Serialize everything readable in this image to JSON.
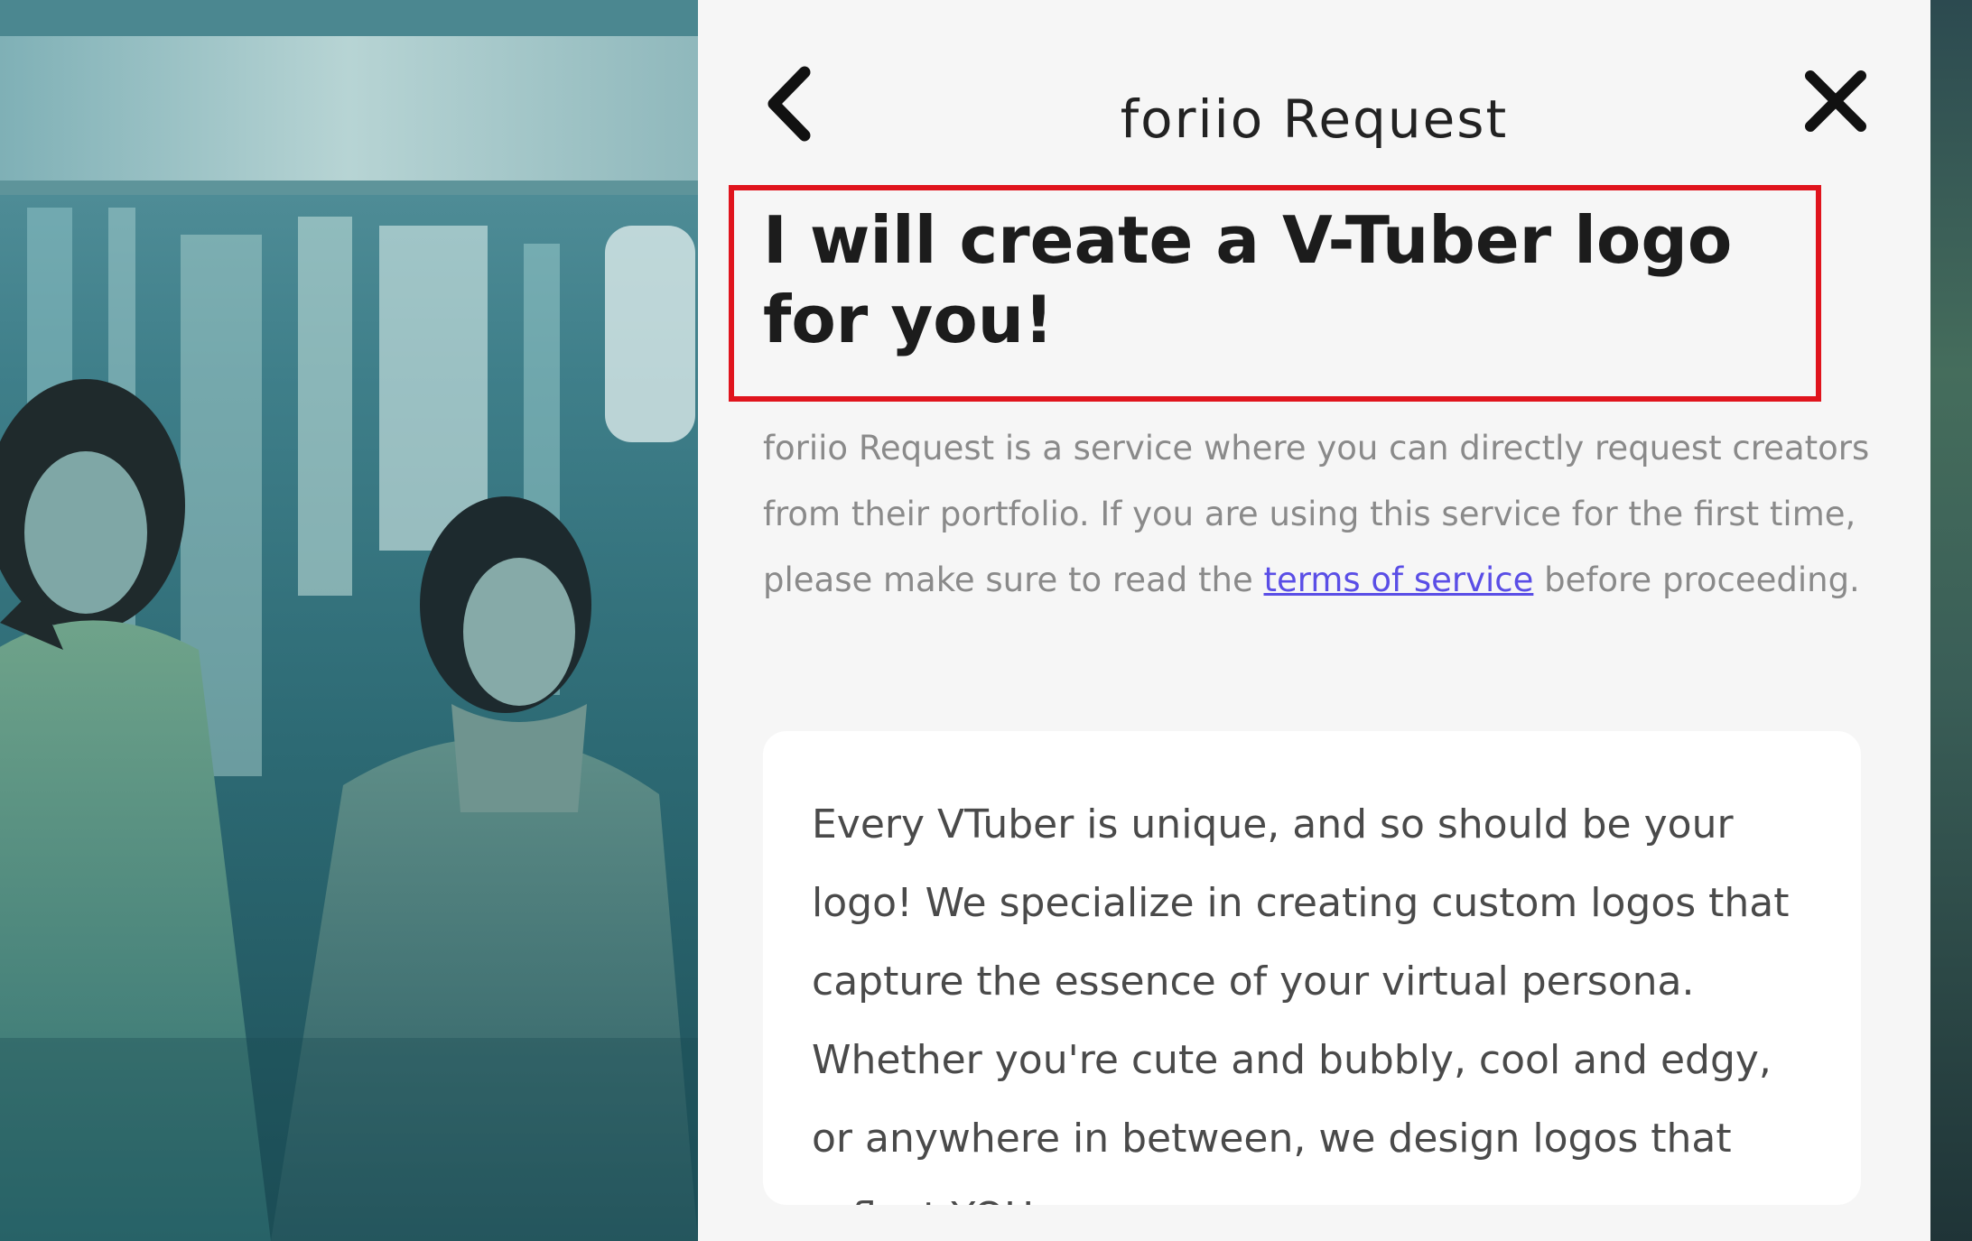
{
  "modal": {
    "title": "foriio Request",
    "back_icon": "chevron-left-icon",
    "close_icon": "close-icon"
  },
  "request": {
    "headline": "I will create a V-Tuber logo for you!",
    "highlight_color": "#e0141d",
    "intro_before_link": "foriio Request is a service where you can directly request creators from their portfolio. If you are using this service for the first time, please make sure to read the ",
    "intro_link": "terms of service",
    "intro_after_link": " before proceeding.",
    "link_color": "#5a4ee6",
    "description": "Every VTuber is unique, and so should be your logo! We specialize in creating custom logos that capture the essence of your virtual persona. Whether you're cute and bubbly, cool and edgy, or anywhere in between, we design logos that reflect YOU."
  },
  "background": {
    "image": "portfolio-artwork-two-figures"
  }
}
